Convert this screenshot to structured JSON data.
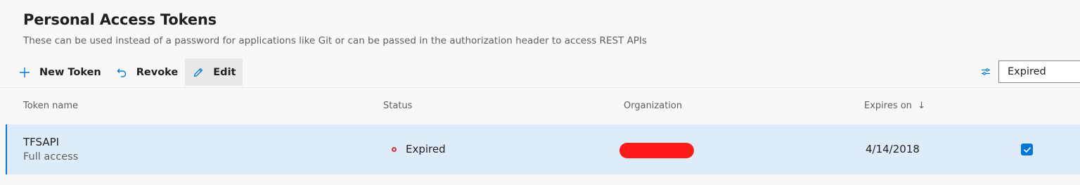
{
  "header": {
    "title": "Personal Access Tokens",
    "subtitle": "These can be used instead of a password for applications like Git or can be passed in the authorization header to access REST APIs"
  },
  "toolbar": {
    "new_token_label": "New Token",
    "new_token_icon": "plus-icon",
    "revoke_label": "Revoke",
    "revoke_icon": "undo-icon",
    "edit_label": "Edit",
    "edit_icon": "pencil-icon"
  },
  "filter": {
    "icon": "filter-settings-icon",
    "value": "Expired"
  },
  "table": {
    "columns": {
      "token_name": "Token name",
      "status": "Status",
      "organization": "Organization",
      "expires_on": "Expires on",
      "expires_sort_icon": "↓"
    },
    "rows": [
      {
        "name": "TFSAPI",
        "scope": "Full access",
        "status": "Expired",
        "organization": "",
        "expires_on": "4/14/2018",
        "selected": true
      }
    ]
  },
  "colors": {
    "accent": "#0078d4",
    "selected_row": "#deecf9",
    "expired_status": "#d13438",
    "redaction": "#ff1a1a"
  }
}
